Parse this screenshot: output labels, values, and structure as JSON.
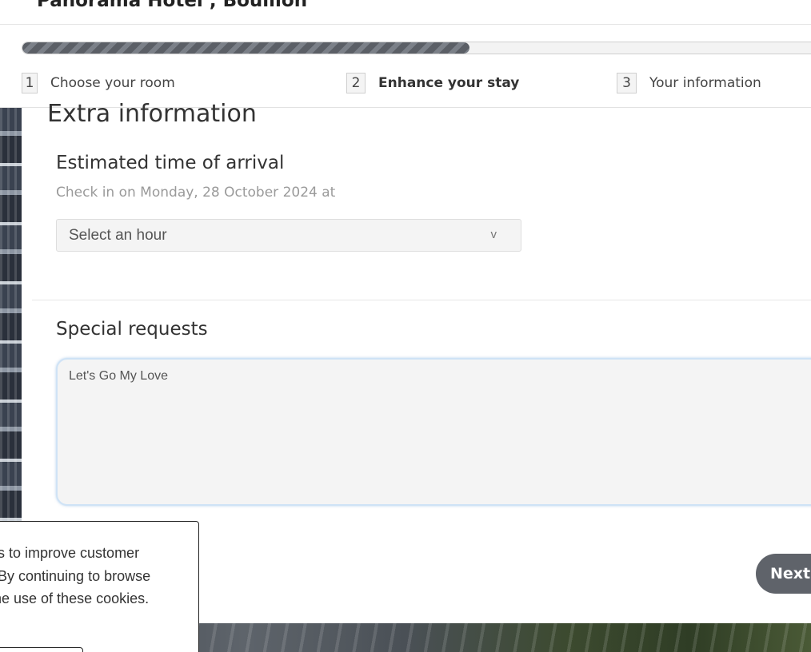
{
  "header": {
    "hotel_name": "Panorama Hotel , Bouillon",
    "progress_fraction": 0.56,
    "steps": [
      {
        "number": "1",
        "label": "Choose your room",
        "active": false
      },
      {
        "number": "2",
        "label": "Enhance your stay",
        "active": true
      },
      {
        "number": "3",
        "label": "Your information",
        "active": false
      }
    ]
  },
  "main": {
    "section_title": "Extra information",
    "eta": {
      "title": "Estimated time of arrival",
      "subtitle": "Check in on Monday, 28 October 2024 at",
      "select_value": "Select an hour",
      "chevron": "v"
    },
    "special_requests": {
      "title": "Special requests",
      "value": "Let's Go My Love"
    },
    "next_label": "Next"
  },
  "cookie": {
    "lines": [
      "es to improve customer",
      ". By continuing to browse",
      "the use of these cookies."
    ]
  },
  "colors": {
    "progress_fill": "#5b5f66",
    "next_button": "#5f636a",
    "textarea_focus": "#cfe3f6"
  }
}
